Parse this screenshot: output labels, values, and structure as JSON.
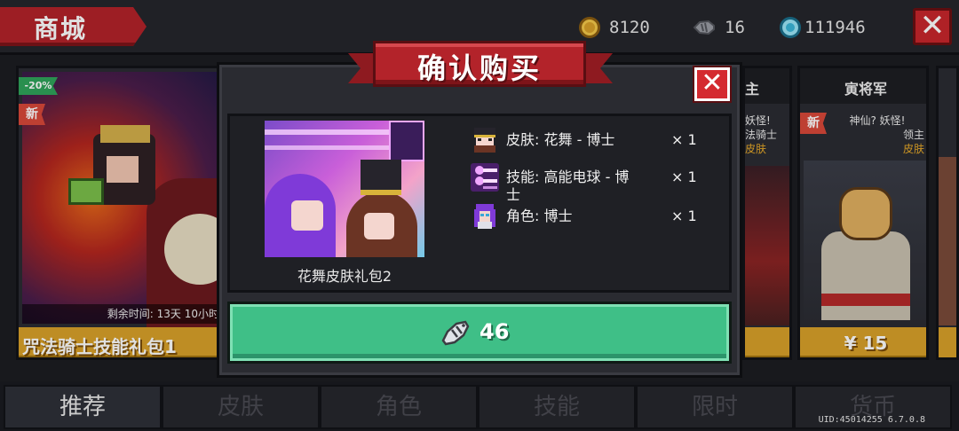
{
  "header": {
    "shop_title": "商城",
    "currencies": [
      {
        "icon": "gold-coin-icon",
        "value": "8120"
      },
      {
        "icon": "fish-icon",
        "value": "16"
      },
      {
        "icon": "gem-icon",
        "value": "111946"
      }
    ],
    "close_glyph": "✕"
  },
  "cards": {
    "left": {
      "discount": "-20%",
      "new_badge": "新",
      "timer": "剩余时间: 13天 10小时",
      "name": "咒法骑士技能礼包1"
    },
    "middle": {
      "title_partial": "主",
      "line1": "妖怪!",
      "line2": "法骑士",
      "line3": "皮肤"
    },
    "right": {
      "title": "寅将军",
      "new_badge": "新",
      "line1": "神仙? 妖怪!",
      "line2": "领主",
      "line3": "皮肤",
      "price": "¥ 15"
    }
  },
  "tabs": [
    {
      "label": "推荐",
      "active": true
    },
    {
      "label": "皮肤",
      "active": false
    },
    {
      "label": "角色",
      "active": false
    },
    {
      "label": "技能",
      "active": false
    },
    {
      "label": "限时",
      "active": false
    },
    {
      "label": "货币",
      "active": false
    }
  ],
  "uid_text": "UID:45014255 6.7.0.8",
  "modal": {
    "title": "确认购买",
    "close_glyph": "✕",
    "pack_name": "花舞皮肤礼包2",
    "items": [
      {
        "icon": "skin-avatar-icon",
        "label": "皮肤: 花舞 - 博士",
        "qty": "× 1"
      },
      {
        "icon": "skill-orb-icon",
        "label": "技能: 高能电球 - 博士",
        "qty": "× 1"
      },
      {
        "icon": "character-avatar-icon",
        "label": "角色: 博士",
        "qty": "× 1"
      }
    ],
    "buy": {
      "currency_icon": "fish-icon",
      "price": "46"
    }
  },
  "colors": {
    "accent_red": "#b3232a",
    "buy_green": "#3fbf87",
    "price_gold": "#d9a12a"
  }
}
